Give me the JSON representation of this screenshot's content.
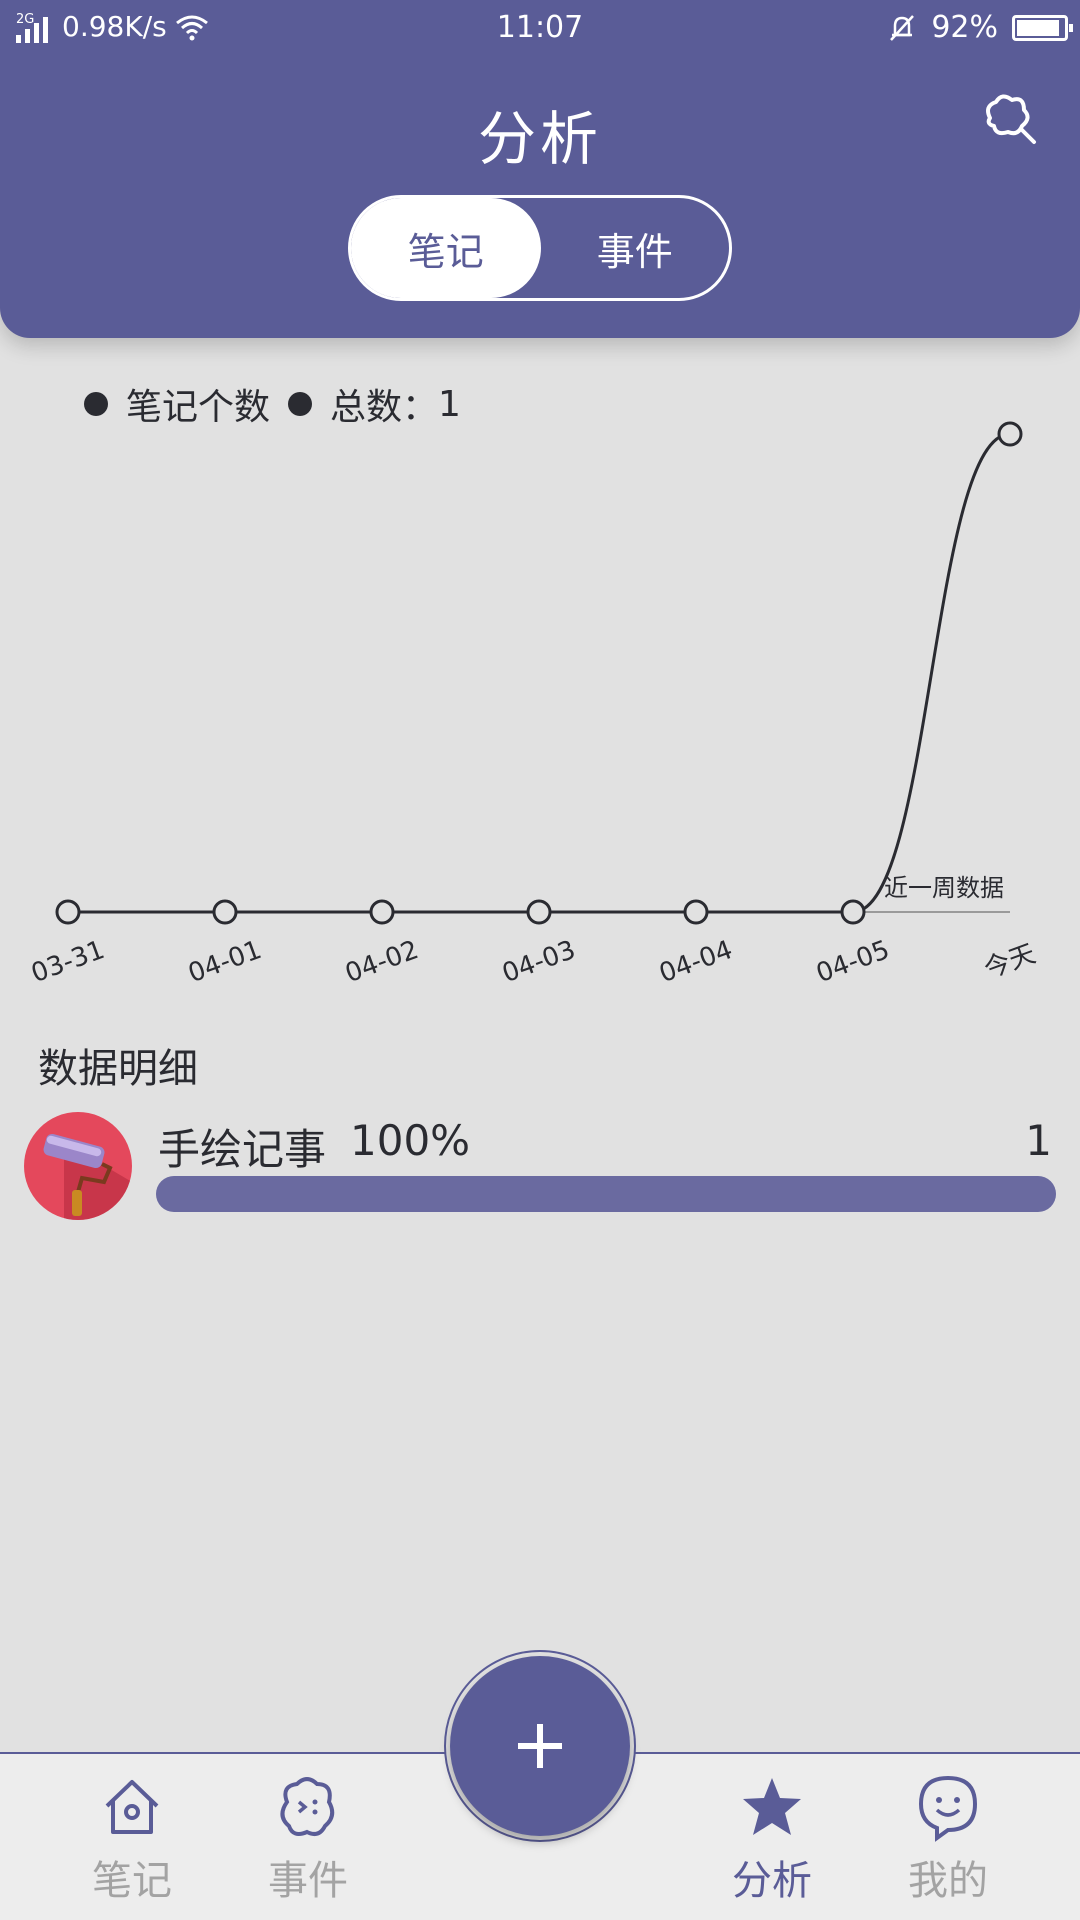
{
  "status_bar": {
    "network_type": "2G",
    "speed": "0.98K/s",
    "time": "11:07",
    "battery": "92%",
    "battery_level": 0.92
  },
  "header": {
    "title": "分析",
    "segments": [
      "笔记",
      "事件"
    ],
    "active_segment": 0
  },
  "legend": {
    "series_label": "笔记个数",
    "total_label": "总数：",
    "total_value": "1"
  },
  "chart_data": {
    "type": "line",
    "categories": [
      "03-31",
      "04-01",
      "04-02",
      "04-03",
      "04-04",
      "04-05",
      "今天"
    ],
    "series": [
      {
        "name": "笔记个数",
        "values": [
          0,
          0,
          0,
          0,
          0,
          0,
          1
        ]
      }
    ],
    "annotation": "近一周数据",
    "ylim": [
      0,
      1
    ]
  },
  "details": {
    "title": "数据明细",
    "items": [
      {
        "label": "手绘记事",
        "percent": "100%",
        "count": "1",
        "fraction": 1.0
      }
    ]
  },
  "tabbar": {
    "tabs": [
      {
        "label": "笔记",
        "icon": "home-icon"
      },
      {
        "label": "事件",
        "icon": "event-icon"
      },
      {
        "label": "分析",
        "icon": "star-icon"
      },
      {
        "label": "我的",
        "icon": "smile-icon"
      }
    ],
    "active_tab": 2,
    "fab_icon": "plus-icon"
  },
  "colors": {
    "primary": "#5a5c97",
    "background": "#e1e1e1",
    "text": "#2a2b31",
    "inactive": "#a3a3a3"
  }
}
